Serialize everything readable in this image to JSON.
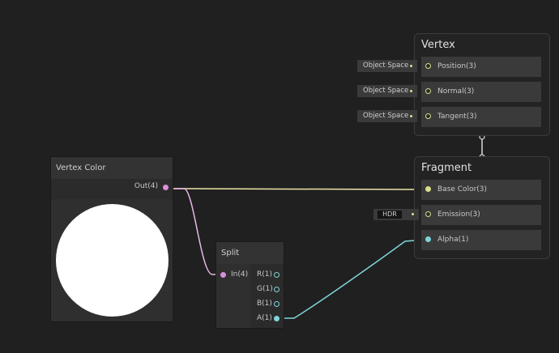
{
  "vertex": {
    "title": "Vertex",
    "slots": [
      {
        "label": "Position(3)",
        "space": "Object Space"
      },
      {
        "label": "Normal(3)",
        "space": "Object Space"
      },
      {
        "label": "Tangent(3)",
        "space": "Object Space"
      }
    ]
  },
  "fragment": {
    "title": "Fragment",
    "slots": [
      {
        "label": "Base Color(3)"
      },
      {
        "label": "Emission(3)",
        "field": "HDR"
      },
      {
        "label": "Alpha(1)"
      }
    ]
  },
  "vertex_color_node": {
    "title": "Vertex Color",
    "output": "Out(4)"
  },
  "split_node": {
    "title": "Split",
    "input": "In(4)",
    "outputs": [
      "R(1)",
      "G(1)",
      "B(1)",
      "A(1)"
    ]
  },
  "colors": {
    "background": "#202020",
    "wire_color": "#ece4a6",
    "wire_vector4": "#e8b8e6",
    "wire_alpha": "#7fd6d8",
    "port_yellow": "#d9e08a",
    "port_pink": "#d98fd9",
    "port_cyan": "#7fd6d8"
  }
}
